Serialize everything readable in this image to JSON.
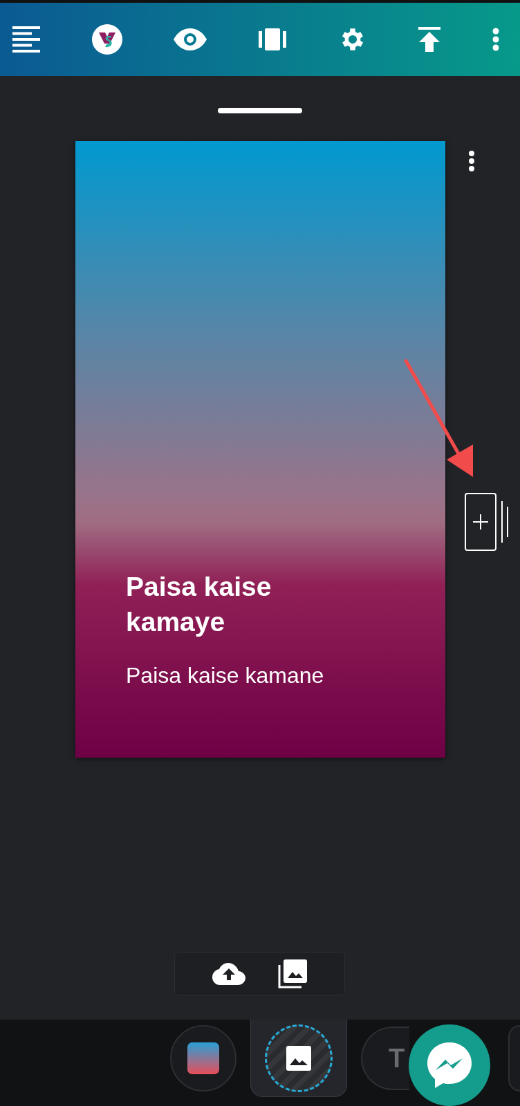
{
  "toolbar": [
    {
      "kind": "outline"
    },
    {
      "kind": "logo"
    },
    {
      "kind": "preview"
    },
    {
      "kind": "pages"
    },
    {
      "kind": "settings"
    },
    {
      "kind": "publish"
    },
    {
      "kind": "more"
    }
  ],
  "story_card": {
    "title": "Paisa kaise kamaye",
    "subtitle": "Paisa kaise kamane"
  },
  "media_popup": [
    {
      "kind": "upload"
    },
    {
      "kind": "gallery"
    }
  ],
  "bottom_tabs": [
    {
      "kind": "background",
      "selected": false
    },
    {
      "kind": "image",
      "selected": true
    },
    {
      "kind": "text",
      "label": "T",
      "selected": false
    },
    {
      "kind": "more",
      "selected": false
    }
  ]
}
